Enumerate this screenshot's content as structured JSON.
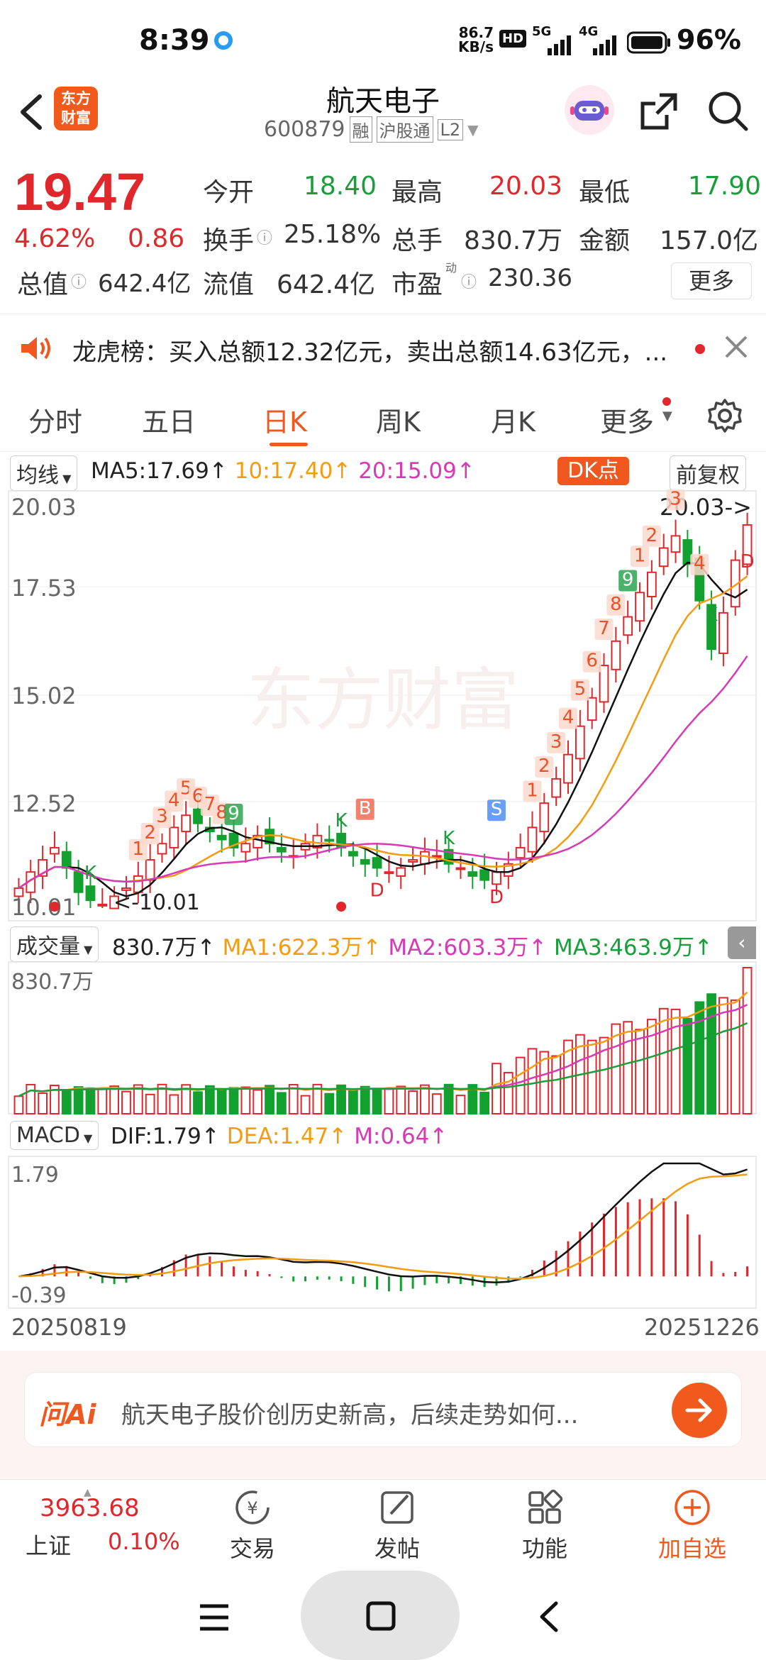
{
  "status_bar": {
    "time": "8:39",
    "net_speed_top": "86.7",
    "net_speed_bottom": "KB/s",
    "hd_label": "HD",
    "signal_1": "5G",
    "signal_2": "4G",
    "battery": "96%"
  },
  "header": {
    "logo_line1": "东方",
    "logo_line2": "财富",
    "stock_name": "航天电子",
    "stock_code": "600879",
    "tag_margin": "融",
    "tag_connect": "沪股通",
    "tag_level": "L2"
  },
  "quote": {
    "price": "19.47",
    "change_pct": "4.62%",
    "change_val": "0.86",
    "open_label": "今开",
    "open_val": "18.40",
    "high_label": "最高",
    "high_val": "20.03",
    "low_label": "最低",
    "low_val": "17.90",
    "turnover_label": "换手",
    "turnover_val": "25.18%",
    "volume_label": "总手",
    "volume_val": "830.7万",
    "amount_label": "金额",
    "amount_val": "157.0亿",
    "mktcap_label": "总值",
    "mktcap_val": "642.4亿",
    "float_label": "流值",
    "float_val": "642.4亿",
    "pe_label": "市盈",
    "pe_sup": "动",
    "pe_val": "230.36",
    "more_label": "更多"
  },
  "notice": {
    "text": "龙虎榜：买入总额12.32亿元，卖出总额14.63亿元，..."
  },
  "tabs": [
    {
      "label": "分时"
    },
    {
      "label": "五日"
    },
    {
      "label": "日K"
    },
    {
      "label": "周K"
    },
    {
      "label": "月K"
    },
    {
      "label": "更多"
    }
  ],
  "kline_header": {
    "ma_label": "均线",
    "ma5": "MA5:17.69",
    "ma10": "10:17.40",
    "ma20": "20:15.09",
    "arrow": "↑",
    "dk_label": "DK点",
    "adjust_label": "前复权"
  },
  "kline_axis": {
    "y_top": "20.03",
    "y_2": "17.53",
    "y_3": "15.02",
    "y_4": "12.52",
    "y_bottom": "10.01",
    "high_note": "20.03->",
    "low_note": "<-10.01",
    "watermark": "东方财富"
  },
  "kline_markers": {
    "nums_left": [
      "1",
      "2",
      "3",
      "4",
      "5",
      "6",
      "7",
      "8"
    ],
    "green_9": "9",
    "k_label": "K",
    "d_label": "D",
    "b_label": "B",
    "s_label": "S",
    "right_nums": [
      "4",
      "3",
      "2",
      "1",
      "9",
      "8",
      "7",
      "6",
      "5",
      "4",
      "3",
      "2",
      "1"
    ]
  },
  "volume_header": {
    "label": "成交量",
    "vol": "830.7万",
    "ma1": "MA1:622.3万",
    "ma2": "MA2:603.3万",
    "ma3": "MA3:463.9万",
    "axis_top": "830.7万"
  },
  "macd_header": {
    "label": "MACD",
    "dif": "DIF:1.79",
    "dea": "DEA:1.47",
    "m": "M:0.64",
    "axis_top": "1.79",
    "axis_bottom": "-0.39"
  },
  "dates": {
    "start": "20250819",
    "end": "20251226"
  },
  "ai_bar": {
    "logo": "问Ai",
    "prompt": "航天电子股价创历史新高，后续走势如何..."
  },
  "bottom_nav": {
    "index_val": "3963.68",
    "index_name": "上证",
    "index_pct": "0.10%",
    "trade": "交易",
    "post": "发帖",
    "func": "功能",
    "add": "加自选"
  },
  "chart_data": {
    "type": "candlestick",
    "ylim": [
      10.01,
      20.03
    ],
    "x_start": "20250819",
    "x_end": "20251226",
    "ma5": 17.69,
    "ma10": 17.4,
    "ma20": 15.09,
    "close": [
      10.5,
      10.9,
      11.2,
      11.5,
      11.0,
      10.4,
      10.2,
      10.1,
      10.3,
      10.5,
      10.8,
      11.2,
      11.6,
      12.0,
      12.3,
      12.1,
      11.9,
      11.7,
      11.5,
      11.6,
      11.8,
      11.6,
      11.4,
      11.3,
      11.6,
      11.8,
      11.7,
      11.5,
      11.3,
      11.1,
      11.0,
      10.9,
      11.0,
      11.2,
      11.4,
      11.3,
      11.1,
      11.0,
      10.8,
      10.7,
      10.9,
      11.1,
      11.5,
      12.0,
      12.6,
      13.2,
      13.8,
      14.5,
      15.2,
      16.0,
      16.6,
      17.2,
      17.8,
      18.3,
      18.9,
      19.2,
      18.5,
      17.6,
      16.4,
      17.3,
      18.6,
      19.47
    ]
  }
}
